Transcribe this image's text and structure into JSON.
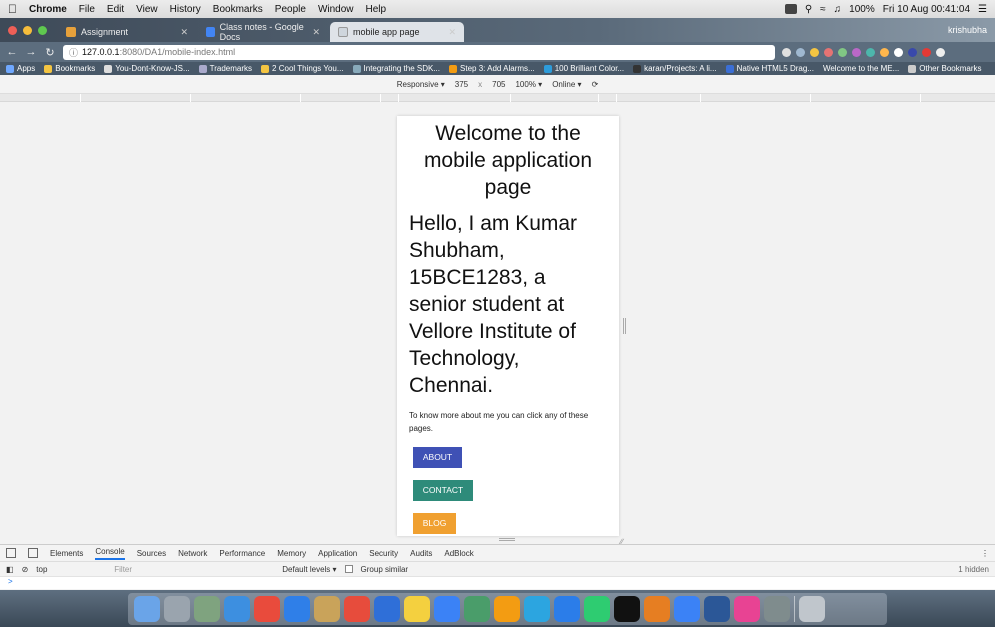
{
  "menubar": {
    "app": "Chrome",
    "items": [
      "File",
      "Edit",
      "View",
      "History",
      "Bookmarks",
      "People",
      "Window",
      "Help"
    ],
    "battery": "100%",
    "clock": "Fri 10 Aug  00:41:04"
  },
  "tabs": [
    {
      "title": "Assignment",
      "icon_color": "#e7a13b"
    },
    {
      "title": "Class notes - Google Docs",
      "icon_color": "#4285f4"
    },
    {
      "title": "mobile app page",
      "icon_color": "#cfd6dd"
    }
  ],
  "user_label": "krishubha",
  "address": {
    "host": "127.0.0.1",
    "path": ":8080/DA1/mobile-index.html"
  },
  "bookmarks": {
    "apps": "Apps",
    "items": [
      "Bookmarks",
      "You-Dont-Know-JS...",
      "Trademarks",
      "2 Cool Things You...",
      "Integrating the SDK...",
      "Step 3: Add Alarms...",
      "100 Brilliant Color...",
      "karan/Projects: A li...",
      "Native HTML5 Drag...",
      "Welcome to the ME..."
    ],
    "other": "Other Bookmarks"
  },
  "device_toolbar": {
    "mode": "Responsive ▾",
    "width": "375",
    "times": "x",
    "height": "705",
    "zoom": "100% ▾",
    "network": "Online ▾"
  },
  "page": {
    "heading": "Welcome to the mobile application page",
    "intro": "Hello, I am Kumar Shubham, 15BCE1283, a senior student at Vellore Institute of Technology, Chennai.",
    "note": "To know more about me you can click any of these pages.",
    "buttons": {
      "about": "ABOUT",
      "contact": "CONTACT",
      "blog": "BLOG"
    },
    "colors": {
      "about": "#3f51b5",
      "contact": "#2e8b7a",
      "blog": "#f0a030"
    }
  },
  "devtools": {
    "tabs": [
      "Elements",
      "Console",
      "Sources",
      "Network",
      "Performance",
      "Memory",
      "Application",
      "Security",
      "Audits",
      "AdBlock"
    ],
    "active_tab": "Console",
    "context": "top",
    "filter_placeholder": "Filter",
    "levels": "Default levels ▾",
    "group_similar": "Group similar",
    "hidden": "1 hidden",
    "prompt": ">"
  },
  "dock": {
    "icon_colors": [
      "#6aa4e8",
      "#9aa4ae",
      "#7fa37f",
      "#3d8fe0",
      "#e94b3c",
      "#2f7fe8",
      "#c9a35a",
      "#e74c3c",
      "#2f6fd8",
      "#f4d03f",
      "#3b82f6",
      "#4a9d6a",
      "#f39c12",
      "#2ca5e0",
      "#2b7de9",
      "#2ecc71",
      "#111111",
      "#e67e22",
      "#3b82f6",
      "#2b5797",
      "#e84393",
      "#7f8c8d",
      "#c0c6cc"
    ]
  }
}
